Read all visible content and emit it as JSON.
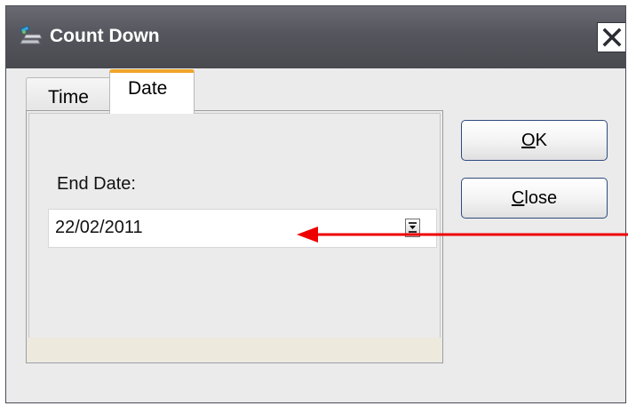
{
  "window": {
    "title": "Count Down",
    "icon": "satellite-icon",
    "close_icon": "close-icon"
  },
  "tabs": [
    {
      "label": "Time",
      "selected": false
    },
    {
      "label": "Date",
      "selected": true
    }
  ],
  "date_tab": {
    "end_date_label": "End Date:",
    "end_date_value": "22/02/2011",
    "spin_icon": "spin-down-icon"
  },
  "buttons": {
    "ok": {
      "mnemonic": "O",
      "rest": "K"
    },
    "close": {
      "mnemonic": "C",
      "rest": "lose"
    }
  },
  "annotation": {
    "type": "arrow",
    "color": "#ee0000"
  }
}
